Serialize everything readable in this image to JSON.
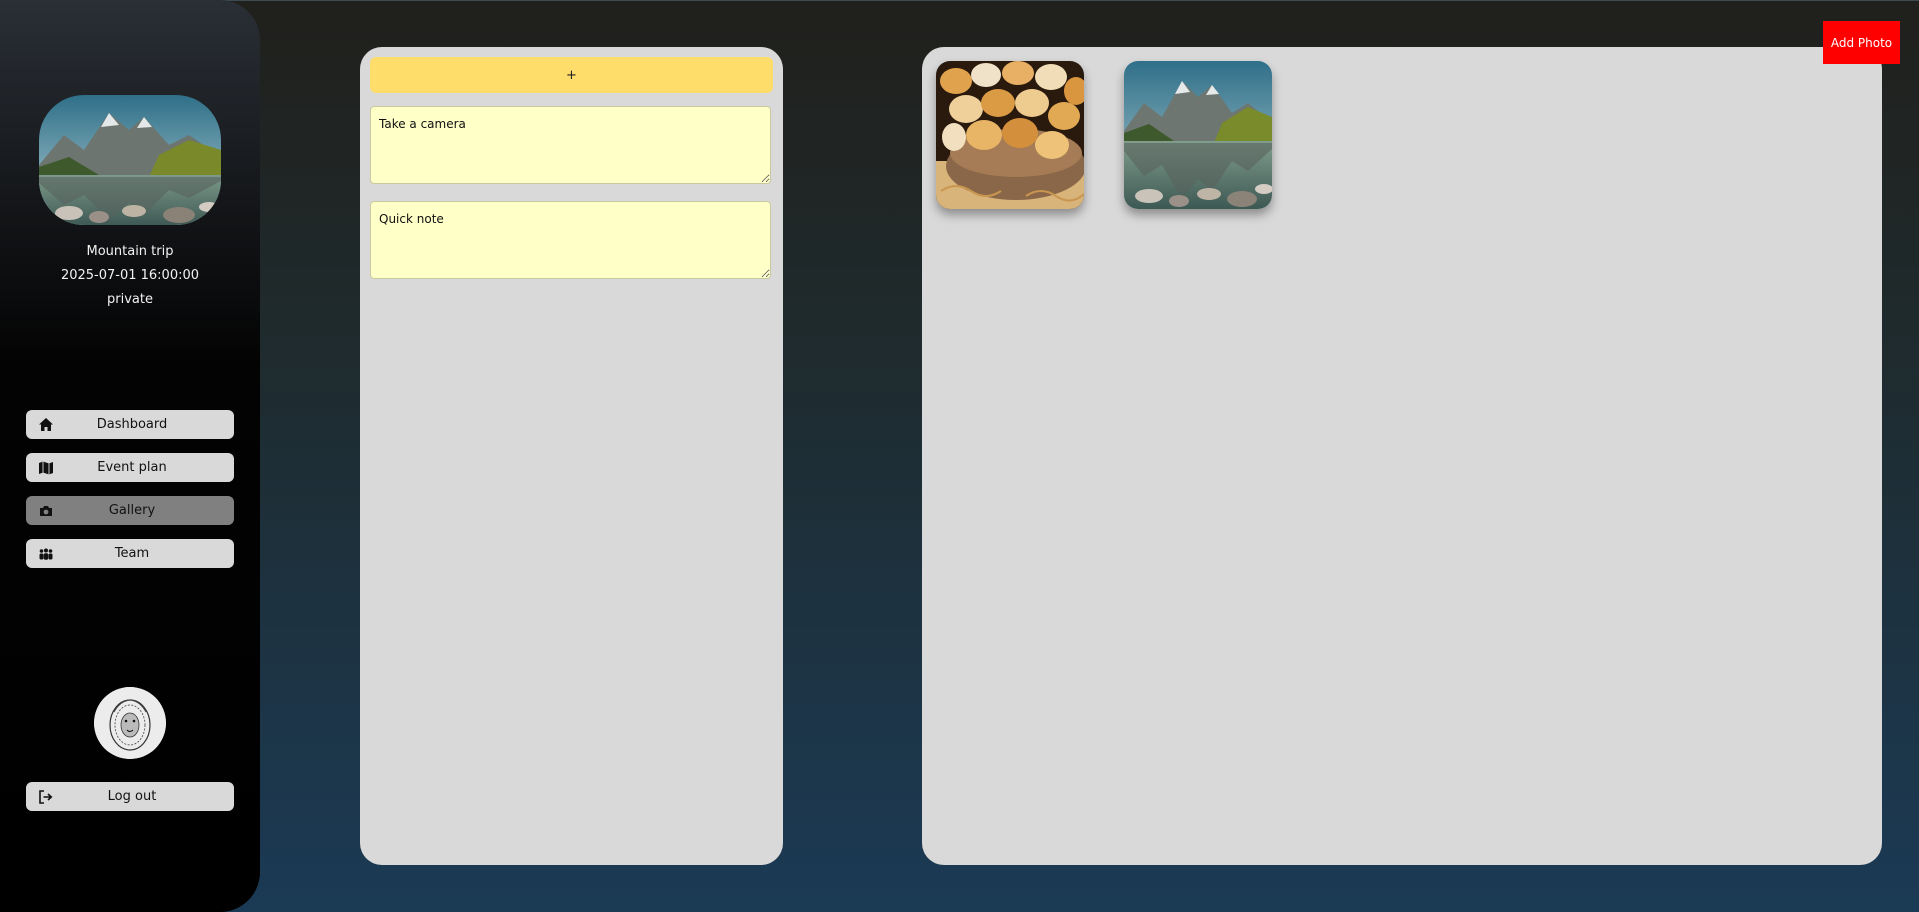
{
  "sidebar": {
    "event": {
      "title": "Mountain trip",
      "datetime": "2025-07-01 16:00:00",
      "visibility": "private",
      "cover_image": "mountain-lake-thumbnail"
    },
    "nav": [
      {
        "label": "Dashboard",
        "icon": "home-icon"
      },
      {
        "label": "Event plan",
        "icon": "map-icon"
      },
      {
        "label": "Gallery",
        "icon": "camera-icon",
        "active": true
      },
      {
        "label": "Team",
        "icon": "team-icon"
      }
    ],
    "avatar": "lion-sketch-avatar",
    "logout_label": "Log out"
  },
  "notes": {
    "add_label": "+",
    "items": [
      {
        "text": "Take a camera"
      },
      {
        "text": "Quick note"
      }
    ]
  },
  "gallery": {
    "photos": [
      {
        "name": "bread-basket-photo"
      },
      {
        "name": "mountain-lake-photo"
      }
    ]
  },
  "toolbar": {
    "add_photo_label": "Add Photo"
  },
  "colors": {
    "accent_red": "#ff0000",
    "note_yellow": "#ffffc8",
    "add_note_yellow": "#ffdd6b",
    "panel_gray": "#d9d9d9",
    "active_nav": "#808080"
  }
}
